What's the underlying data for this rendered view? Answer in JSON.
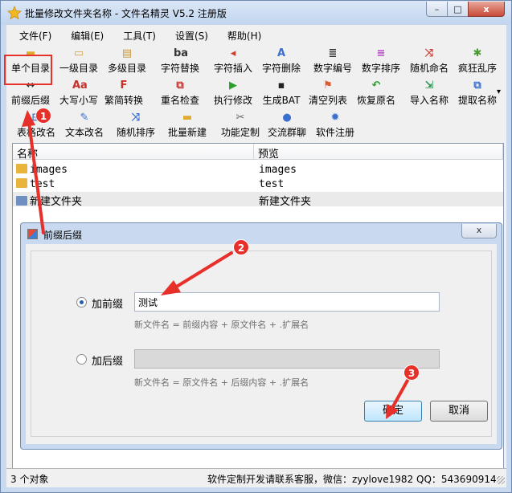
{
  "window": {
    "title": "批量修改文件夹名称 - 文件名精灵 V5.2 注册版",
    "minimize": "–",
    "maximize": "□",
    "close": "x"
  },
  "menu": [
    "文件(F)",
    "编辑(E)",
    "工具(T)",
    "设置(S)",
    "帮助(H)"
  ],
  "toolbar": {
    "row1": [
      {
        "label": "单个目录",
        "icon": "folder-icon",
        "glyph": "▬",
        "color": "#e0a930"
      },
      {
        "label": "一级目录",
        "icon": "folder-open-icon",
        "glyph": "▭",
        "color": "#d0a040"
      },
      {
        "label": "多级目录",
        "icon": "folder-tree-icon",
        "glyph": "▤",
        "color": "#c8983a"
      },
      {
        "label": "字符替换",
        "icon": "replace-ab-icon",
        "glyph": "ba",
        "color": "#333333"
      },
      {
        "label": "字符插入",
        "icon": "insert-icon",
        "glyph": "◂",
        "color": "#d23a2e"
      },
      {
        "label": "字符删除",
        "icon": "delete-a-icon",
        "glyph": "A",
        "color": "#3a6fd0"
      },
      {
        "label": "数字编号",
        "icon": "numbered-list-icon",
        "glyph": "≣",
        "color": "#333333"
      },
      {
        "label": "数字排序",
        "icon": "sort-lines-icon",
        "glyph": "≡",
        "color": "#b040c0"
      },
      {
        "label": "随机命名",
        "icon": "shuffle-icon",
        "glyph": "⤨",
        "color": "#d23a2e"
      },
      {
        "label": "疯狂乱序",
        "icon": "bug-icon",
        "glyph": "✱",
        "color": "#4a9a30"
      }
    ],
    "row2": [
      {
        "label": "前缀后缀",
        "icon": "arrows-left-right-icon",
        "glyph": "↔",
        "color": "#222222"
      },
      {
        "label": "大写小写",
        "icon": "case-aa-icon",
        "glyph": "Aa",
        "color": "#c8302a"
      },
      {
        "label": "繁简转换",
        "icon": "convert-f-icon",
        "glyph": "F",
        "color": "#c8302a"
      },
      {
        "label": "重名检查",
        "icon": "check-copy-icon",
        "glyph": "⧉",
        "color": "#c8302a"
      },
      {
        "label": "执行修改",
        "icon": "play-icon",
        "glyph": "▶",
        "color": "#2aa02a"
      },
      {
        "label": "生成BAT",
        "icon": "terminal-icon",
        "glyph": "▪",
        "color": "#222222"
      },
      {
        "label": "清空列表",
        "icon": "broom-icon",
        "glyph": "⚑",
        "color": "#e05a30"
      },
      {
        "label": "恢复原名",
        "icon": "undo-icon",
        "glyph": "↶",
        "color": "#2aa02a"
      },
      {
        "label": "导入名称",
        "icon": "import-icon",
        "glyph": "⇲",
        "color": "#2a8a4a"
      },
      {
        "label": "提取名称",
        "icon": "extract-icon",
        "glyph": "⧉",
        "color": "#3a6fd0"
      }
    ],
    "row3": [
      {
        "label": "表格改名",
        "icon": "table-icon",
        "glyph": "⊞",
        "color": "#3a6fd0"
      },
      {
        "label": "文本改名",
        "icon": "text-edit-icon",
        "glyph": "✎",
        "color": "#3a6fd0"
      },
      {
        "label": "随机排序",
        "icon": "random-sort-icon",
        "glyph": "⤨",
        "color": "#3a6fd0"
      },
      {
        "label": "批量新建",
        "icon": "new-folder-icon",
        "glyph": "▬",
        "color": "#e0a930"
      },
      {
        "label": "功能定制",
        "icon": "tools-icon",
        "glyph": "✂",
        "color": "#666666"
      },
      {
        "label": "交流群聊",
        "icon": "chat-icon",
        "glyph": "●",
        "color": "#3a6fd0"
      },
      {
        "label": "软件注册",
        "icon": "gear-icon",
        "glyph": "✹",
        "color": "#3a6fd0"
      }
    ],
    "overflow": "▾"
  },
  "filelist": {
    "columns": [
      "名称",
      "预览"
    ],
    "rows": [
      {
        "name": "images",
        "preview": "images"
      },
      {
        "name": "test",
        "preview": "test"
      },
      {
        "name": "新建文件夹",
        "preview": "新建文件夹"
      }
    ]
  },
  "status": {
    "count": "3 个对象",
    "contact": "软件定制开发请联系客服，微信：zyylove1982   QQ：543690914"
  },
  "dialog": {
    "title": "前缀后缀",
    "close": "x",
    "prefix_label": "加前缀",
    "prefix_value": "测试",
    "prefix_hint": "新文件名 = 前缀内容 + 原文件名 + .扩展名",
    "suffix_label": "加后缀",
    "suffix_value": "",
    "suffix_hint": "新文件名 = 原文件名 + 后缀内容 + .扩展名",
    "ok": "确定",
    "cancel": "取消"
  },
  "annotations": [
    "1",
    "2",
    "3"
  ],
  "colors": {
    "annotation": "#e8302a",
    "titlebar": "#c9daf0"
  }
}
